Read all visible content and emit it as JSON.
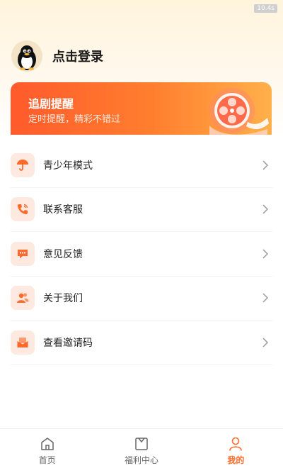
{
  "status_tag": "10.4s",
  "profile": {
    "login_label": "点击登录",
    "avatar_icon": "penguin-avatar-icon"
  },
  "banner": {
    "title": "追剧提醒",
    "subtitle": "定时提醒，精彩不错过",
    "art_icon": "film-reel-icon"
  },
  "menu": [
    {
      "label": "青少年模式",
      "icon": "umbrella-icon"
    },
    {
      "label": "联系客服",
      "icon": "phone-icon"
    },
    {
      "label": "意见反馈",
      "icon": "chat-bubble-icon"
    },
    {
      "label": "关于我们",
      "icon": "users-icon"
    },
    {
      "label": "查看邀请码",
      "icon": "envelope-icon"
    }
  ],
  "tabbar": [
    {
      "label": "首页",
      "icon": "home-icon",
      "active": false
    },
    {
      "label": "福利中心",
      "icon": "gift-box-icon",
      "active": false
    },
    {
      "label": "我的",
      "icon": "profile-icon",
      "active": true
    }
  ],
  "colors": {
    "accent": "#ff6a2a",
    "banner_start": "#ff5a2c",
    "banner_end": "#ffb04a",
    "icon_bg": "#fde9df"
  }
}
